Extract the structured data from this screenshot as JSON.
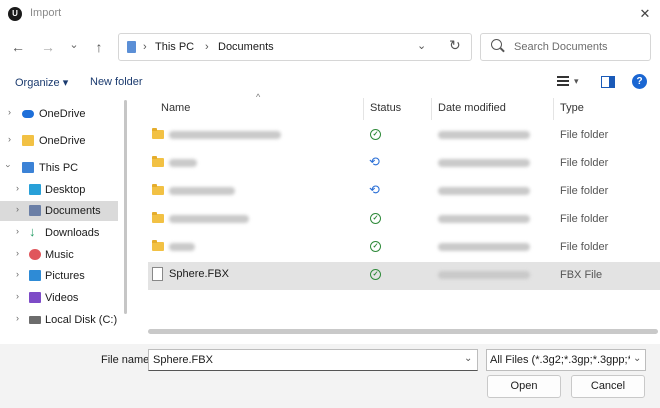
{
  "window": {
    "title": "Import",
    "logo_text": "U"
  },
  "nav": {
    "back_glyph": "←",
    "forward_glyph": "→",
    "recent_glyph": "⌄",
    "up_glyph": "↑",
    "breadcrumb": [
      "This PC",
      "Documents"
    ],
    "separator": "›",
    "refresh_glyph": "↻",
    "dropdown_glyph": "⌄"
  },
  "search": {
    "placeholder": "Search Documents"
  },
  "toolbar": {
    "organize_label": "Organize ▾",
    "new_folder_label": "New folder",
    "help_glyph": "?"
  },
  "sidebar": {
    "items": [
      {
        "label": "OneDrive",
        "icon": "cloud-icon",
        "color": "#1e6fd9"
      },
      {
        "label": "OneDrive",
        "icon": "folder-icon",
        "color": "#f2c144"
      },
      {
        "label": "This PC",
        "icon": "computer-icon",
        "color": "#3b82d6"
      },
      {
        "label": "Desktop",
        "icon": "desktop-icon",
        "color": "#28a0d8"
      },
      {
        "label": "Documents",
        "icon": "documents-icon",
        "color": "#6b7fa6"
      },
      {
        "label": "Downloads",
        "icon": "downloads-icon",
        "color": "#1f9a61"
      },
      {
        "label": "Music",
        "icon": "music-icon",
        "color": "#e0565b"
      },
      {
        "label": "Pictures",
        "icon": "pictures-icon",
        "color": "#2e8bd6"
      },
      {
        "label": "Videos",
        "icon": "videos-icon",
        "color": "#7d4bc7"
      },
      {
        "label": "Local Disk (C:)",
        "icon": "disk-icon",
        "color": "#6c6c6c"
      }
    ]
  },
  "columns": {
    "name": "Name",
    "status": "Status",
    "date": "Date modified",
    "type": "Type"
  },
  "files": [
    {
      "name": "",
      "status": "synced",
      "type": "File folder",
      "kind": "folder"
    },
    {
      "name": "",
      "status": "syncing",
      "type": "File folder",
      "kind": "folder"
    },
    {
      "name": "",
      "status": "syncing",
      "type": "File folder",
      "kind": "folder"
    },
    {
      "name": "",
      "status": "synced",
      "type": "File folder",
      "kind": "folder"
    },
    {
      "name": "",
      "status": "synced",
      "type": "File folder",
      "kind": "folder"
    },
    {
      "name": "Sphere.FBX",
      "status": "synced",
      "type": "FBX File",
      "kind": "file"
    }
  ],
  "footer": {
    "file_name_label": "File name:",
    "file_name_value": "Sphere.FBX",
    "filter_value": "All Files (*.3g2;*.3gp;*.3gpp;*.3g",
    "open_label": "Open",
    "cancel_label": "Cancel"
  },
  "colors": {
    "accent": "#1a66d2",
    "selected_row": "#e3e3e3",
    "folder": "#f2c144"
  }
}
